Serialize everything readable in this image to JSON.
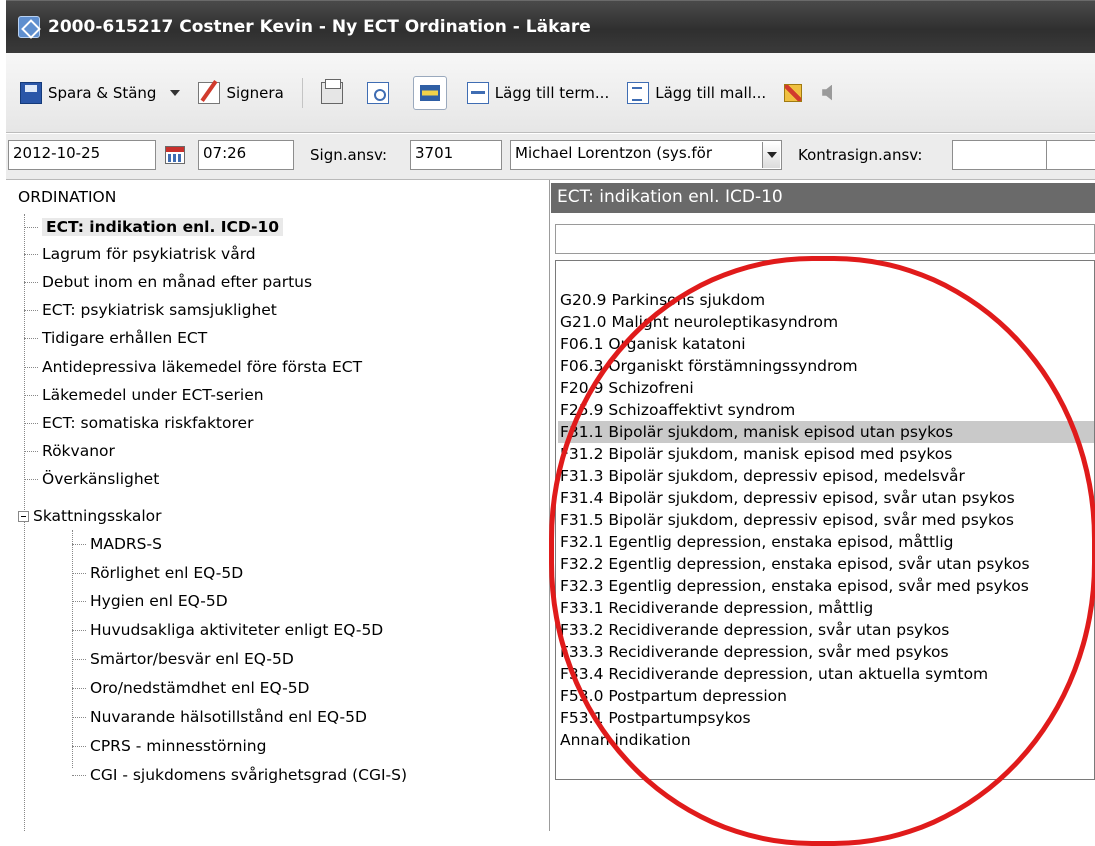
{
  "window": {
    "title": "2000-615217 Costner Kevin - Ny ECT Ordination - Läkare"
  },
  "toolbar": {
    "save_label": "Spara & Stäng",
    "sign_label": "Signera",
    "add_term_label": "Lägg till term...",
    "add_template_label": "Lägg till mall...",
    "icons": [
      "save-icon",
      "sign-icon",
      "print-icon",
      "preview-icon",
      "layout-icon",
      "add-term-icon",
      "add-template-icon",
      "clear-icon",
      "speaker-icon"
    ]
  },
  "form": {
    "date": "2012-10-25",
    "time": "07:26",
    "sign_resp_label": "Sign.ansv:",
    "sign_resp_code": "3701",
    "sign_resp_name": "Michael Lorentzon (sys.för",
    "countersign_label": "Kontrasign.ansv:",
    "countersign_code": "",
    "countersign_name": ""
  },
  "tree": {
    "root": "ORDINATION",
    "items": [
      "ECT: indikation enl. ICD-10",
      "Lagrum för psykiatrisk vård",
      "Debut inom en månad efter partus",
      "ECT: psykiatrisk samsjuklighet",
      "Tidigare erhållen ECT",
      "Antidepressiva läkemedel före första ECT",
      "Läkemedel under ECT-serien",
      "ECT: somatiska riskfaktorer",
      "Rökvanor",
      "Överkänslighet",
      "Skattningsskalor"
    ],
    "selected_index": 0,
    "sub_items": [
      "MADRS-S",
      "Rörlighet enl EQ-5D",
      "Hygien enl EQ-5D",
      "Huvudsakliga aktiviteter enligt EQ-5D",
      "Smärtor/besvär enl EQ-5D",
      "Oro/nedstämdhet enl EQ-5D",
      "Nuvarande hälsotillstånd enl EQ-5D",
      "CPRS - minnesstörning",
      "CGI - sjukdomens svårighetsgrad (CGI-S)"
    ]
  },
  "panel": {
    "header": "ECT: indikation enl. ICD-10",
    "search_value": "",
    "options": [
      "G20.9 Parkinsons sjukdom",
      "G21.0 Malignt neuroleptikasyndrom",
      "F06.1 Organisk katatoni",
      "F06.3 Organiskt förstämningssyndrom",
      "F20.9 Schizofreni",
      "F25.9 Schizoaffektivt syndrom",
      "F31.1 Bipolär sjukdom, manisk episod utan psykos",
      "F31.2 Bipolär sjukdom, manisk episod med psykos",
      "F31.3 Bipolär sjukdom, depressiv episod, medelsvår",
      "F31.4 Bipolär sjukdom, depressiv episod, svår utan psykos",
      "F31.5 Bipolär sjukdom, depressiv episod, svår med psykos",
      "F32.1 Egentlig depression, enstaka episod, måttlig",
      "F32.2 Egentlig depression, enstaka episod, svår utan psykos",
      "F32.3 Egentlig depression, enstaka episod, svår med psykos",
      "F33.1 Recidiverande depression, måttlig",
      "F33.2 Recidiverande depression, svår utan psykos",
      "F33.3 Recidiverande depression,  svår med psykos",
      "F33.4 Recidiverande depression, utan aktuella symtom",
      "F53.0 Postpartum depression",
      "F53.1 Postpartumpsykos",
      "Annan indikation"
    ],
    "selected_index": 6
  },
  "colors": {
    "annotation": "#e01b1b",
    "header_bg": "#6a6a6a",
    "titlebar_bg": "#333333",
    "selection": "#c9c9c9"
  }
}
